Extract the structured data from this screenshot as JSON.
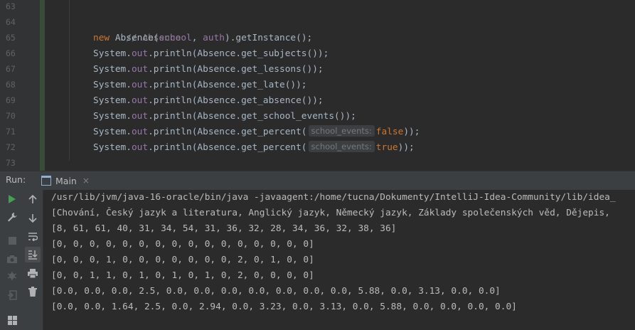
{
  "editor": {
    "line_numbers": [
      "63",
      "64",
      "65",
      "66",
      "67",
      "68",
      "69",
      "70",
      "71",
      "72",
      "73"
    ],
    "comment": "// Absence",
    "line65": {
      "kw": "new",
      "cls": "Absence",
      "p1": "(",
      "arg1": "school",
      "sep": ", ",
      "arg2": "auth",
      "rest": ").getInstance();"
    },
    "println_lines": [
      {
        "sys": "System",
        "dot": ".",
        "out": "out",
        "call": ".println(",
        "cls": "Absence",
        "method": ".get_subjects());"
      },
      {
        "sys": "System",
        "dot": ".",
        "out": "out",
        "call": ".println(",
        "cls": "Absence",
        "method": ".get_lessons());"
      },
      {
        "sys": "System",
        "dot": ".",
        "out": "out",
        "call": ".println(",
        "cls": "Absence",
        "method": ".get_late());"
      },
      {
        "sys": "System",
        "dot": ".",
        "out": "out",
        "call": ".println(",
        "cls": "Absence",
        "method": ".get_absence());"
      },
      {
        "sys": "System",
        "dot": ".",
        "out": "out",
        "call": ".println(",
        "cls": "Absence",
        "method": ".get_school_events());"
      }
    ],
    "percent_lines": [
      {
        "sys": "System",
        "dot": ".",
        "out": "out",
        "call": ".println(",
        "cls": "Absence",
        "method": ".get_percent(",
        "hint": "school_events:",
        "value": "false",
        "end": "));"
      },
      {
        "sys": "System",
        "dot": ".",
        "out": "out",
        "call": ".println(",
        "cls": "Absence",
        "method": ".get_percent(",
        "hint": "school_events:",
        "value": "true",
        "end": "));"
      }
    ]
  },
  "run_window": {
    "label": "Run:",
    "tab_title": "Main",
    "tab_close": "×"
  },
  "toolbar_icons": {
    "left": [
      "run-icon",
      "wrench-icon",
      "stop-icon",
      "camera-icon",
      "debug-icon",
      "exit-icon",
      "layout-icon"
    ],
    "right": [
      "arrow-up-icon",
      "arrow-down-icon",
      "soft-wrap-icon",
      "scroll-to-end-icon",
      "print-icon",
      "trash-icon"
    ]
  },
  "console": {
    "lines": [
      "/usr/lib/jvm/java-16-oracle/bin/java -javaagent:/home/tucna/Dokumenty/IntelliJ-Idea-Community/lib/idea_",
      "[Chování, Český jazyk a literatura, Anglický jazyk, Německý jazyk, Základy společenských věd, Dějepis,",
      "[8, 61, 61, 40, 31, 34, 54, 31, 36, 32, 28, 34, 36, 32, 38, 36]",
      "[0, 0, 0, 0, 0, 0, 0, 0, 0, 0, 0, 0, 0, 0, 0, 0]",
      "[0, 0, 0, 1, 0, 0, 0, 0, 0, 0, 0, 2, 0, 1, 0, 0]",
      "[0, 0, 1, 1, 0, 1, 0, 1, 0, 1, 0, 2, 0, 0, 0, 0]",
      "[0.0, 0.0, 0.0, 2.5, 0.0, 0.0, 0.0, 0.0, 0.0, 0.0, 0.0, 5.88, 0.0, 3.13, 0.0, 0.0]",
      "[0.0, 0.0, 1.64, 2.5, 0.0, 2.94, 0.0, 3.23, 0.0, 3.13, 0.0, 5.88, 0.0, 0.0, 0.0, 0.0]"
    ]
  }
}
